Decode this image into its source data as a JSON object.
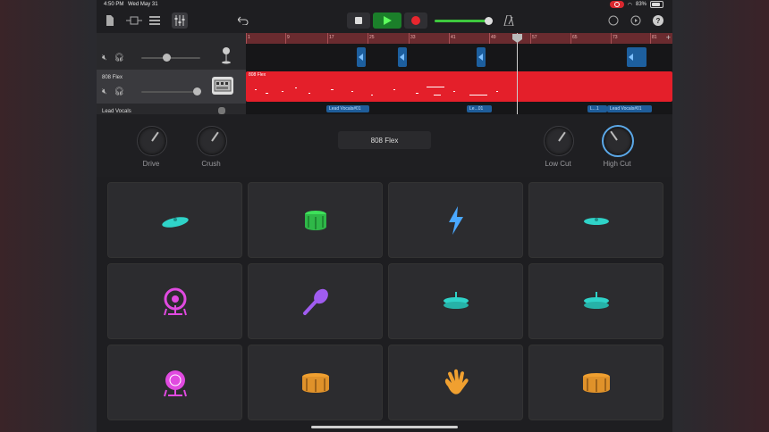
{
  "status_bar": {
    "time": "4:50 PM",
    "date": "Wed May 31",
    "battery": "83%"
  },
  "toolbar": {
    "icons": [
      "document-icon",
      "track-view-icon",
      "list-view-icon",
      "mixer-icon",
      "undo-icon"
    ],
    "right_icons": [
      "metronome-icon",
      "loop-icon",
      "settings-icon",
      "help-icon"
    ]
  },
  "ruler": {
    "marks": [
      "1",
      "9",
      "17",
      "25",
      "33",
      "41",
      "49",
      "57",
      "65",
      "73",
      "81"
    ]
  },
  "tracks": [
    {
      "name": "",
      "instrument": "microphone"
    },
    {
      "name": "808 Flex",
      "instrument": "drum-machine"
    },
    {
      "name": "Lead Vocals",
      "instrument": "microphone"
    }
  ],
  "regions": {
    "drum_region_label": "808 Flex",
    "vocal_labels": [
      "Lead Vocals#01",
      "Le...01",
      "L...1",
      "Lead Vocals#01"
    ]
  },
  "controls": {
    "kit_name": "808 Flex",
    "knobs": [
      {
        "label": "Drive"
      },
      {
        "label": "Crush"
      },
      {
        "label": "Low Cut"
      },
      {
        "label": "High Cut"
      }
    ]
  },
  "pads": [
    {
      "icon": "cymbal-icon",
      "color": "#2fd3c8"
    },
    {
      "icon": "snare-drum-icon",
      "color": "#3ee05a"
    },
    {
      "icon": "lightning-icon",
      "color": "#4aa8ff"
    },
    {
      "icon": "cymbal-icon",
      "color": "#2fd3c8"
    },
    {
      "icon": "kick-drum-icon",
      "color": "#e04ae0"
    },
    {
      "icon": "maraca-icon",
      "color": "#a05cf0"
    },
    {
      "icon": "hihat-icon",
      "color": "#2fd3c8"
    },
    {
      "icon": "hihat-icon",
      "color": "#2fd3c8"
    },
    {
      "icon": "kick-drum-icon",
      "color": "#e04ae0"
    },
    {
      "icon": "tom-drum-icon",
      "color": "#f0a030"
    },
    {
      "icon": "hand-clap-icon",
      "color": "#f0a030"
    },
    {
      "icon": "tom-drum-icon",
      "color": "#f0a030"
    }
  ]
}
